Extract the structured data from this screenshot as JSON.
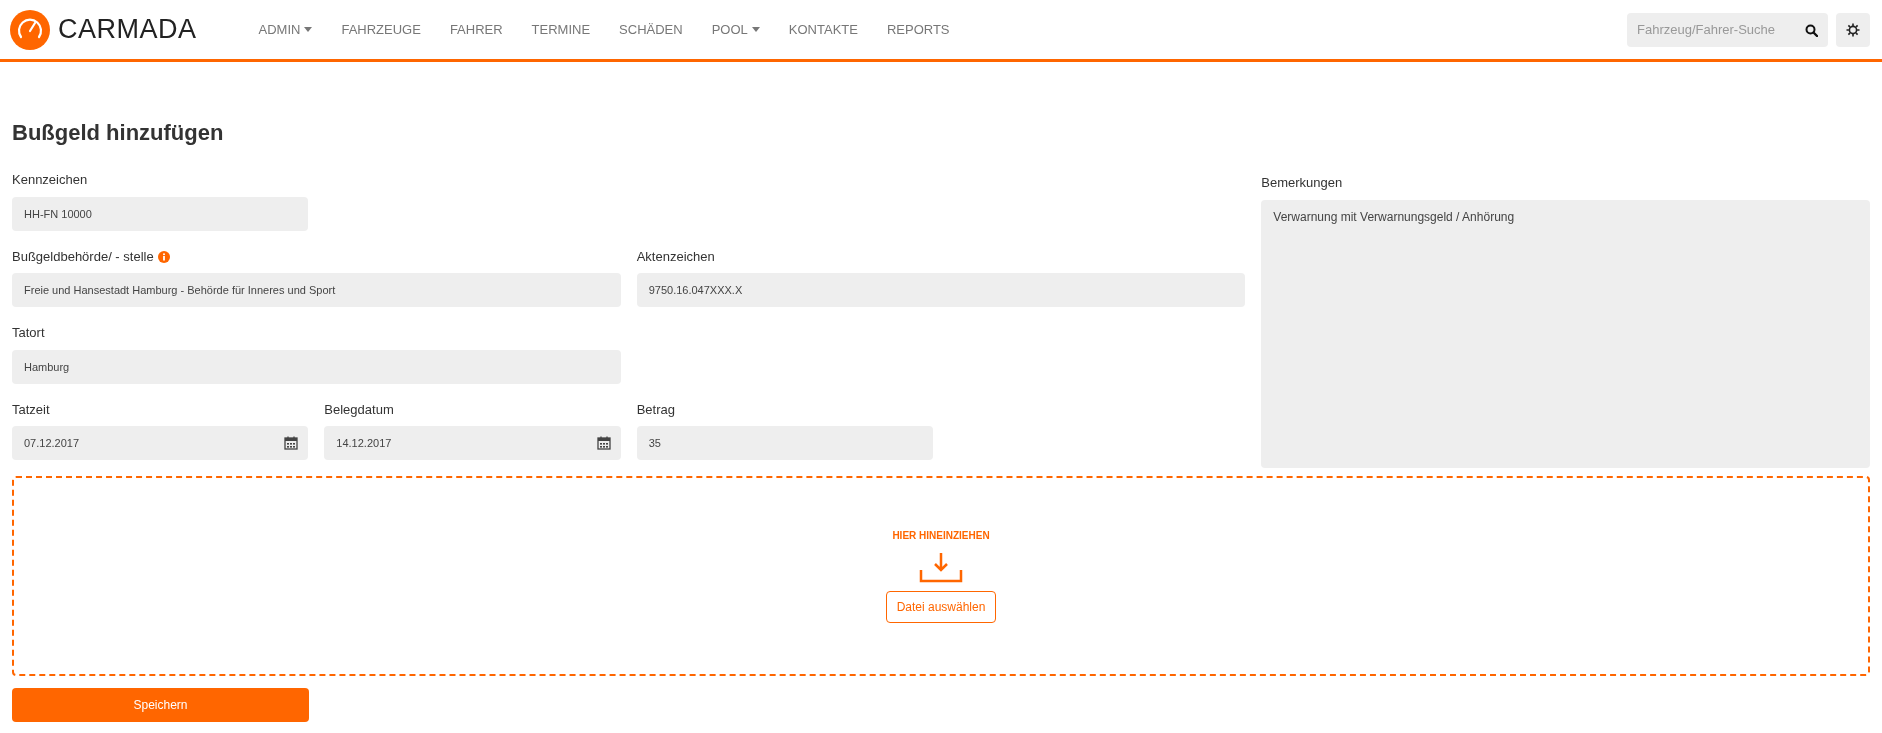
{
  "brand": "CARMADA",
  "nav": [
    {
      "label": "ADMIN",
      "dropdown": true
    },
    {
      "label": "FAHRZEUGE",
      "dropdown": false
    },
    {
      "label": "FAHRER",
      "dropdown": false
    },
    {
      "label": "TERMINE",
      "dropdown": false
    },
    {
      "label": "SCHÄDEN",
      "dropdown": false
    },
    {
      "label": "POOL",
      "dropdown": true
    },
    {
      "label": "KONTAKTE",
      "dropdown": false
    },
    {
      "label": "REPORTS",
      "dropdown": false
    }
  ],
  "search": {
    "placeholder": "Fahrzeug/Fahrer-Suche"
  },
  "title": "Bußgeld hinzufügen",
  "rows": [
    [
      {
        "label": "Kennzeichen",
        "value": "HH-FN 10000",
        "kind": "text",
        "info": false
      }
    ],
    [
      {
        "label": "Bußgeldbehörde/ - stelle",
        "value": "Freie und Hansestadt Hamburg - Behörde für Inneres und Sport",
        "kind": "text",
        "info": true
      },
      {
        "label": "Aktenzeichen",
        "value": "9750.16.047XXX.X",
        "kind": "text",
        "info": false
      }
    ],
    [
      {
        "label": "Tatort",
        "value": "Hamburg",
        "kind": "text",
        "info": false
      }
    ],
    [
      {
        "label": "Tatzeit",
        "value": "07.12.2017",
        "kind": "date",
        "info": false
      },
      {
        "label": "Belegdatum",
        "value": "14.12.2017",
        "kind": "date",
        "info": false
      },
      {
        "label": "Betrag",
        "value": "35",
        "kind": "text",
        "info": false
      }
    ]
  ],
  "remarks": {
    "label": "Bemerkungen",
    "value": "Verwarnung mit Verwarnungsgeld / Anhörung"
  },
  "dropzone": {
    "hint": "HIER HINEINZIEHEN",
    "button": "Datei auswählen"
  },
  "save_button": "Speichern"
}
